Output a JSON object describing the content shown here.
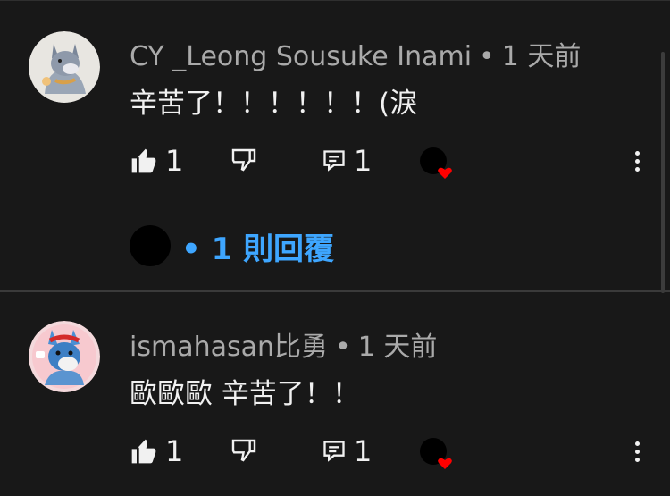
{
  "comments": [
    {
      "author": "CY _Leong Sousuke Inami",
      "separator": "•",
      "time": "1 天前",
      "text": "辛苦了！！！！！！(淚",
      "like_count": "1",
      "reply_count": "1",
      "replies_link": "• 1 則回覆"
    },
    {
      "author": "ismahasan比勇",
      "separator": "•",
      "time": "1 天前",
      "text": "歐歐歐 辛苦了！！",
      "like_count": "1",
      "reply_count": "1"
    }
  ],
  "icons": {
    "like": "thumbs-up-filled-icon",
    "dislike": "thumbs-down-outline-icon",
    "reply": "reply-comment-icon",
    "creator_heart": "creator-heart-icon",
    "more": "more-vertical-icon"
  },
  "colors": {
    "background": "#181818",
    "text": "#f1f1f1",
    "meta": "#aaaaaa",
    "link": "#3ea6ff",
    "heart": "#ff0000"
  }
}
